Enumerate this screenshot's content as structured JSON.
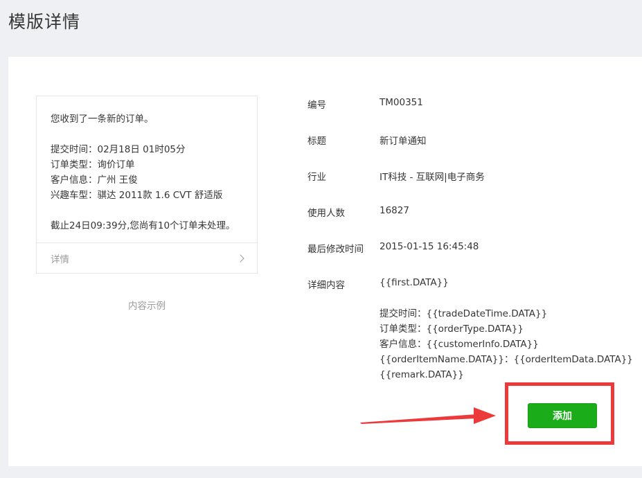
{
  "page": {
    "title": "模版详情"
  },
  "preview": {
    "intro": "您收到了一条新的订单。",
    "lines": [
      "提交时间：02月18日 01时05分",
      "订单类型：询价订单",
      "客户信息：广州 王俊",
      "兴趣车型：骐达 2011款 1.6 CVT 舒适版"
    ],
    "remark": "截止24日09:39分,您尚有10个订单未处理。",
    "detail_label": "详情",
    "caption": "内容示例"
  },
  "info": {
    "number_label": "编号",
    "number_value": "TM00351",
    "title_label": "标题",
    "title_value": "新订单通知",
    "industry_label": "行业",
    "industry_value": "IT科技 - 互联网|电子商务",
    "users_label": "使用人数",
    "users_value": "16827",
    "modified_label": "最后修改时间",
    "modified_value": "2015-01-15 16:45:48",
    "content_label": "详细内容",
    "content_first": "{{first.DATA}}",
    "content_lines": [
      "提交时间：{{tradeDateTime.DATA}}",
      "订单类型：{{orderType.DATA}}",
      "客户信息：{{customerInfo.DATA}}",
      "{{orderItemName.DATA}}：{{orderItemData.DATA}}",
      "{{remark.DATA}}"
    ]
  },
  "actions": {
    "add_label": "添加"
  },
  "colors": {
    "accent": "#1aad19",
    "highlight": "#ec3939"
  }
}
